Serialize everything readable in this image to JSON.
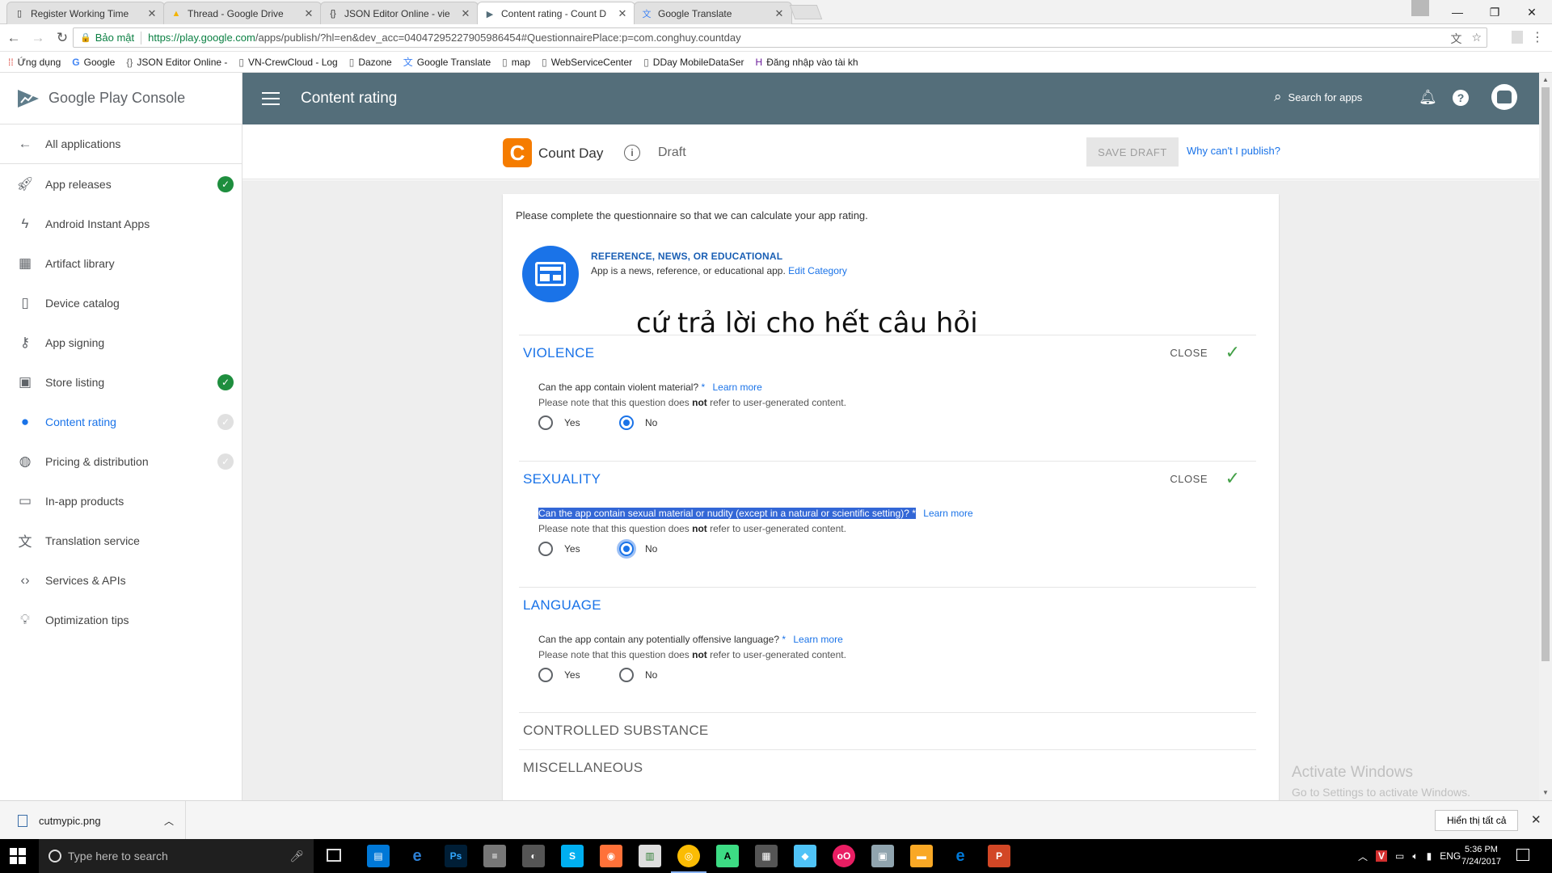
{
  "browser": {
    "tabs": [
      {
        "title": "Register Working Time",
        "active": false
      },
      {
        "title": "Thread - Google Drive",
        "active": false
      },
      {
        "title": "JSON Editor Online - vie",
        "active": false
      },
      {
        "title": "Content rating - Count D",
        "active": true
      },
      {
        "title": "Google Translate",
        "active": false
      }
    ],
    "secure_label": "Bảo mật",
    "url_host": "https://play.google.com",
    "url_path": "/apps/publish/?hl=en&dev_acc=04047295227905986454#QuestionnairePlace:p=com.conghuy.countday",
    "bookmarks": [
      {
        "label": "Ứng dụng",
        "icon": "apps-grid-icon"
      },
      {
        "label": "Google",
        "icon": "google-g-icon"
      },
      {
        "label": "JSON Editor Online -",
        "icon": "json-editor-icon"
      },
      {
        "label": "VN-CrewCloud - Log",
        "icon": "page-icon"
      },
      {
        "label": "Dazone",
        "icon": "page-icon"
      },
      {
        "label": "Google Translate",
        "icon": "translate-icon"
      },
      {
        "label": "map",
        "icon": "page-icon"
      },
      {
        "label": "WebServiceCenter",
        "icon": "page-icon"
      },
      {
        "label": "DDay MobileDataSer",
        "icon": "page-icon"
      },
      {
        "label": "Đăng nhập vào tài kh",
        "icon": "login-icon"
      }
    ]
  },
  "console": {
    "brand": "Google Play Console",
    "page_title": "Content rating",
    "search_label": "Search for apps",
    "nav": [
      {
        "label": "All applications",
        "icon": "arrow-left-icon",
        "status": "none"
      },
      {
        "label": "App releases",
        "icon": "rocket-icon",
        "status": "done"
      },
      {
        "label": "Android Instant Apps",
        "icon": "bolt-icon",
        "status": "none"
      },
      {
        "label": "Artifact library",
        "icon": "library-icon",
        "status": "none"
      },
      {
        "label": "Device catalog",
        "icon": "device-icon",
        "status": "none"
      },
      {
        "label": "App signing",
        "icon": "key-icon",
        "status": "none"
      },
      {
        "label": "Store listing",
        "icon": "store-icon",
        "status": "done"
      },
      {
        "label": "Content rating",
        "icon": "rating-icon",
        "status": "pending"
      },
      {
        "label": "Pricing & distribution",
        "icon": "globe-icon",
        "status": "pending"
      },
      {
        "label": "In-app products",
        "icon": "card-icon",
        "status": "none"
      },
      {
        "label": "Translation service",
        "icon": "translate-icon",
        "status": "none"
      },
      {
        "label": "Services & APIs",
        "icon": "api-icon",
        "status": "none"
      },
      {
        "label": "Optimization tips",
        "icon": "bulb-icon",
        "status": "none"
      }
    ],
    "app": {
      "name": "Count Day",
      "icon_letter": "C",
      "status": "Draft",
      "save_draft": "SAVE DRAFT",
      "why_publish": "Why can't I publish?"
    },
    "questionnaire": {
      "intro": "Please complete the questionnaire so that we can calculate your app rating.",
      "category_title": "REFERENCE, NEWS, OR EDUCATIONAL",
      "category_desc": "App is a news, reference, or educational app.",
      "edit_category": "Edit Category",
      "overlay_note": "cứ trả lời cho hết câu hỏi",
      "close_label": "CLOSE",
      "note_prefix": "Please note that this question does",
      "note_bold": "not",
      "note_suffix": "refer to user-generated content.",
      "learn_more": "Learn more",
      "yes": "Yes",
      "no": "No",
      "sections": [
        {
          "title": "VIOLENCE",
          "question": "Can the app contain violent material?",
          "answer": "No"
        },
        {
          "title": "SEXUALITY",
          "question": "Can the app contain sexual material or nudity (except in a natural or scientific setting)?",
          "answer": "No"
        },
        {
          "title": "LANGUAGE",
          "question": "Can the app contain any potentially offensive language?",
          "answer": "none"
        },
        {
          "title": "CONTROLLED SUBSTANCE"
        },
        {
          "title": "MISCELLANEOUS"
        }
      ]
    },
    "watermark": {
      "line1": "Activate Windows",
      "line2": "Go to Settings to activate Windows."
    }
  },
  "downloads": {
    "file": "cutmypic.png",
    "show_all": "Hiển thị tất cả"
  },
  "taskbar": {
    "search_placeholder": "Type here to search",
    "lang": "ENG",
    "time": "5:36 PM",
    "date": "7/24/2017"
  },
  "colors": {
    "topbar": "#546e7a",
    "accent": "#1a73e8",
    "done": "#1e8e3e",
    "app_icon": "#f57c00"
  }
}
